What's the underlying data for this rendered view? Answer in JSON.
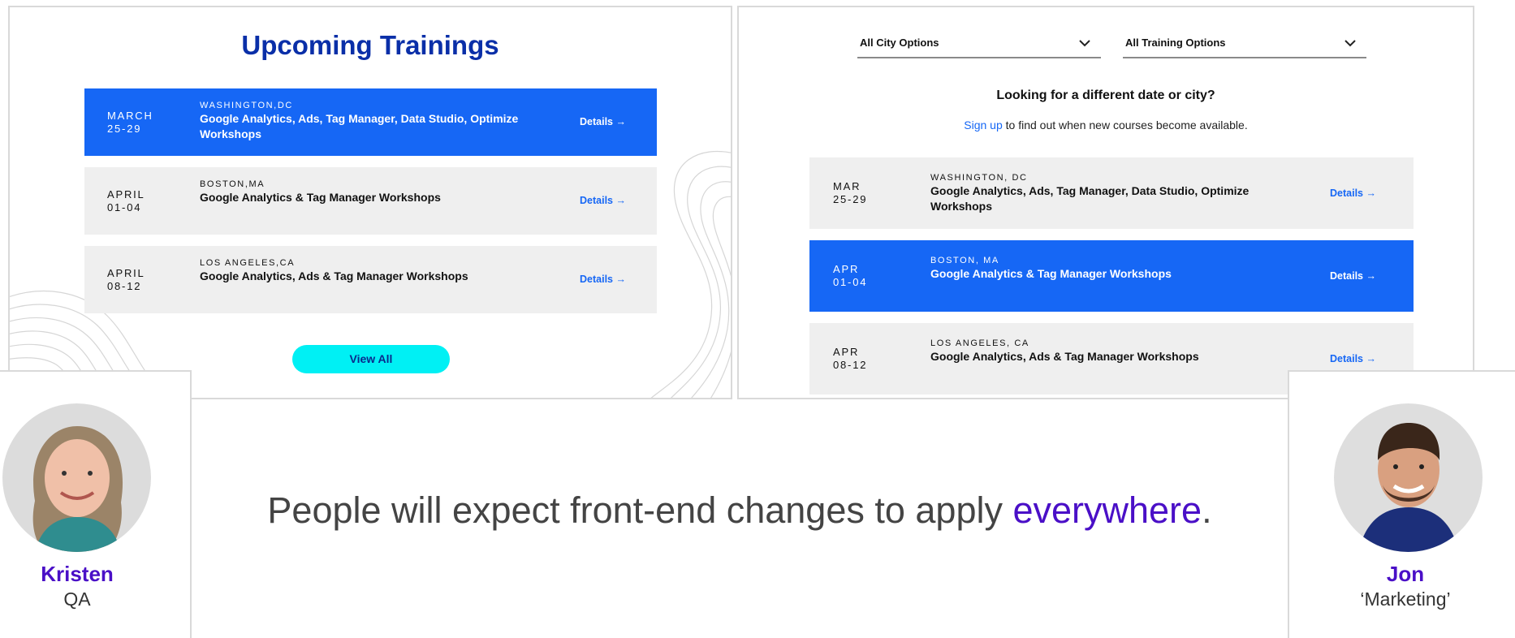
{
  "left_panel": {
    "title": "Upcoming Trainings",
    "rows": [
      {
        "month": "MARCH",
        "days": "25-29",
        "city": "WASHINGTON,DC",
        "course": "Google Analytics, Ads, Tag Manager, Data Studio, Optimize Workshops",
        "details": "Details →",
        "active": true
      },
      {
        "month": "APRIL",
        "days": "01-04",
        "city": "BOSTON,MA",
        "course": "Google Analytics & Tag Manager Workshops",
        "details": "Details →",
        "active": false
      },
      {
        "month": "APRIL",
        "days": "08-12",
        "city": "LOS ANGELES,CA",
        "course": "Google Analytics, Ads & Tag Manager Workshops",
        "details": "Details →",
        "active": false
      }
    ],
    "view_all": "View All"
  },
  "right_panel": {
    "city_select": "All City Options",
    "training_select": "All Training Options",
    "heading": "Looking for a different date or city?",
    "signup_link": "Sign up",
    "signup_rest": " to find out when new courses become available.",
    "rows": [
      {
        "month": "MAR",
        "days": "25-29",
        "city": "WASHINGTON, DC",
        "course": "Google Analytics, Ads, Tag Manager, Data Studio, Optimize Workshops",
        "details": "Details →",
        "active": false
      },
      {
        "month": "APR",
        "days": "01-04",
        "city": "BOSTON, MA",
        "course": "Google Analytics & Tag Manager Workshops",
        "details": "Details →",
        "active": true
      },
      {
        "month": "APR",
        "days": "08-12",
        "city": "LOS ANGELES, CA",
        "course": "Google Analytics, Ads & Tag Manager Workshops",
        "details": "Details →",
        "active": false
      }
    ]
  },
  "people": {
    "left": {
      "name": "Kristen",
      "role": "QA"
    },
    "right": {
      "name": "Jon",
      "role": "‘Marketing’"
    }
  },
  "quote": {
    "before": "People will expect front-end changes to apply ",
    "highlight": "everywhere",
    "after": "."
  },
  "colors": {
    "title_blue": "#0a2fa8",
    "row_active": "#1667f5",
    "row_default": "#efefef",
    "button_cyan": "#00f0f4",
    "accent_purple": "#4a0fc7"
  },
  "icons": [
    "chevron-down-icon",
    "arrow-right-icon"
  ]
}
